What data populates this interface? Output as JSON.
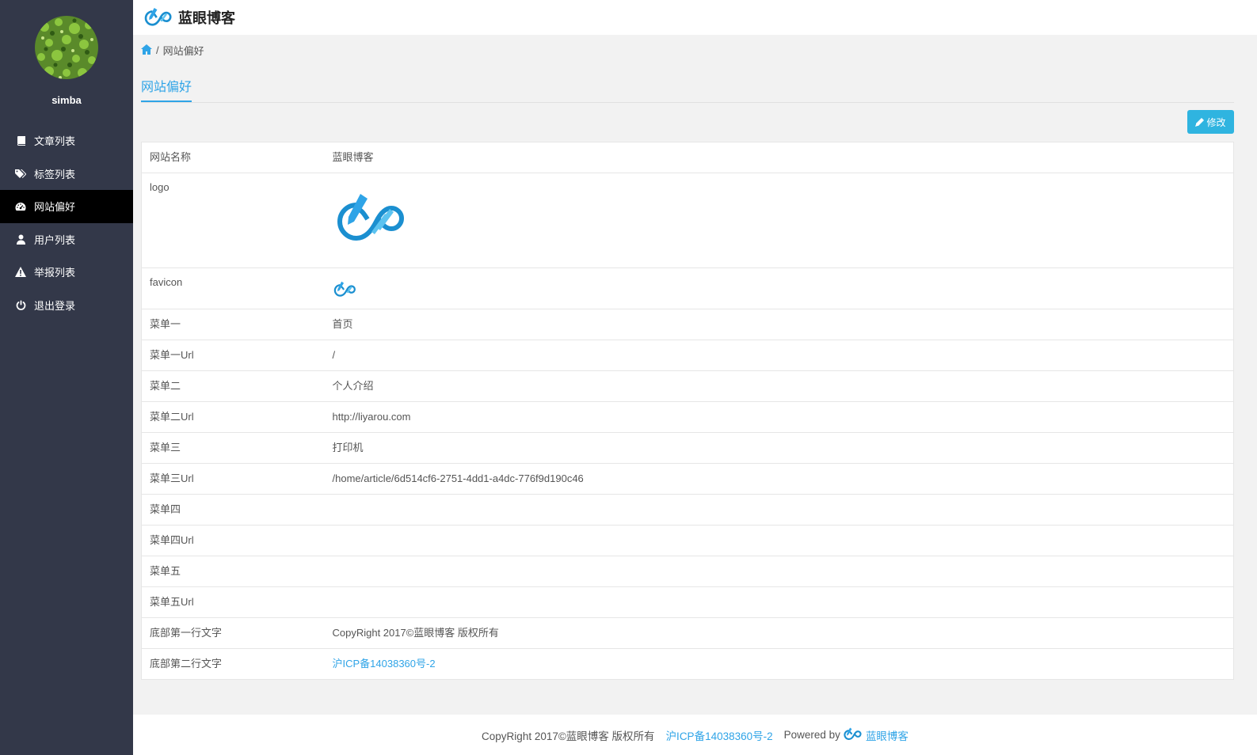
{
  "header": {
    "brand_name": "蓝眼博客",
    "logo_icon": "infinity-pen-logo"
  },
  "sidebar": {
    "username": "simba",
    "items": [
      {
        "label": "文章列表",
        "icon": "book-icon"
      },
      {
        "label": "标签列表",
        "icon": "tags-icon"
      },
      {
        "label": "网站偏好",
        "icon": "dashboard-icon",
        "active": true
      },
      {
        "label": "用户列表",
        "icon": "user-icon"
      },
      {
        "label": "举报列表",
        "icon": "warning-icon"
      },
      {
        "label": "退出登录",
        "icon": "power-icon"
      }
    ]
  },
  "breadcrumb": {
    "separator": "/",
    "current": "网站偏好"
  },
  "tabs": {
    "active": "网站偏好"
  },
  "edit_button": {
    "label": "修改"
  },
  "settings": {
    "site_name": {
      "key": "网站名称",
      "value": "蓝眼博客"
    },
    "logo": {
      "key": "logo"
    },
    "favicon": {
      "key": "favicon"
    },
    "menu1": {
      "key": "菜单一",
      "value": "首页"
    },
    "menu1_url": {
      "key": "菜单一Url",
      "value": "/"
    },
    "menu2": {
      "key": "菜单二",
      "value": "个人介绍"
    },
    "menu2_url": {
      "key": "菜单二Url",
      "value": "http://liyarou.com"
    },
    "menu3": {
      "key": "菜单三",
      "value": "打印机"
    },
    "menu3_url": {
      "key": "菜单三Url",
      "value": "/home/article/6d514cf6-2751-4dd1-a4dc-776f9d190c46"
    },
    "menu4": {
      "key": "菜单四",
      "value": ""
    },
    "menu4_url": {
      "key": "菜单四Url",
      "value": ""
    },
    "menu5": {
      "key": "菜单五",
      "value": ""
    },
    "menu5_url": {
      "key": "菜单五Url",
      "value": ""
    },
    "footer_line1": {
      "key": "底部第一行文字",
      "value": "CopyRight 2017©蓝眼博客 版权所有"
    },
    "footer_line2": {
      "key": "底部第二行文字",
      "value": "沪ICP备14038360号-2"
    }
  },
  "footer": {
    "copyright": "CopyRight 2017©蓝眼博客 版权所有",
    "icp": "沪ICP备14038360号-2",
    "powered_by": "Powered by",
    "brand": "蓝眼博客"
  },
  "colors": {
    "accent": "#2fa4e7",
    "sidebar_bg": "#333849",
    "button_bg": "#2fb4e0"
  }
}
